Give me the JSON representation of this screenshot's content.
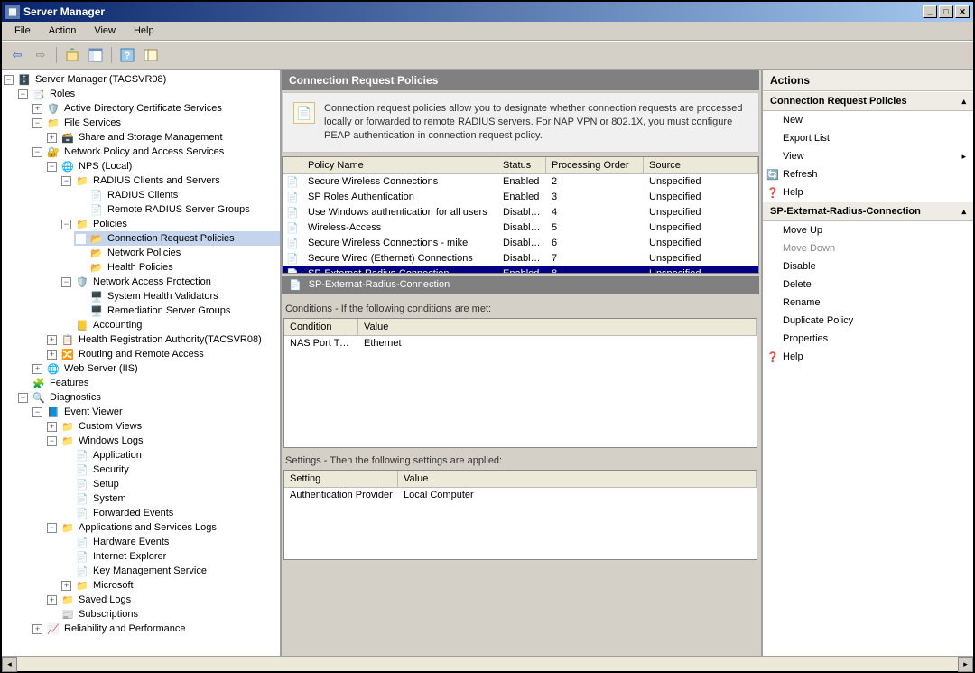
{
  "window": {
    "title": "Server Manager"
  },
  "menu": [
    "File",
    "Action",
    "View",
    "Help"
  ],
  "tree_root": "Server Manager (TACSVR08)",
  "tree": {
    "roles": "Roles",
    "adcs": "Active Directory Certificate Services",
    "file_services": "File Services",
    "share_storage": "Share and Storage Management",
    "npas": "Network Policy and Access Services",
    "nps_local": "NPS (Local)",
    "radius_cs": "RADIUS Clients and Servers",
    "radius_clients": "RADIUS Clients",
    "remote_radius": "Remote RADIUS Server Groups",
    "policies": "Policies",
    "crp": "Connection Request Policies",
    "network_policies": "Network Policies",
    "health_policies": "Health Policies",
    "nap": "Network Access Protection",
    "shv": "System Health Validators",
    "rsg": "Remediation Server Groups",
    "accounting": "Accounting",
    "hra": "Health Registration Authority(TACSVR08)",
    "rras": "Routing and Remote Access",
    "web_server": "Web Server (IIS)",
    "features": "Features",
    "diagnostics": "Diagnostics",
    "event_viewer": "Event Viewer",
    "custom_views": "Custom Views",
    "windows_logs": "Windows Logs",
    "app_log": "Application",
    "sec_log": "Security",
    "setup_log": "Setup",
    "system_log": "System",
    "fwd_events": "Forwarded Events",
    "app_svc_logs": "Applications and Services Logs",
    "hw_events": "Hardware Events",
    "ie": "Internet Explorer",
    "kms": "Key Management Service",
    "microsoft": "Microsoft",
    "saved_logs": "Saved Logs",
    "subscriptions": "Subscriptions",
    "reliability": "Reliability and Performance"
  },
  "center": {
    "title": "Connection Request Policies",
    "info": "Connection request policies allow you to designate whether connection requests are processed locally or forwarded to remote RADIUS servers. For NAP VPN or 802.1X, you must configure PEAP authentication in connection request policy.",
    "columns": {
      "name": "Policy Name",
      "status": "Status",
      "order": "Processing Order",
      "source": "Source"
    },
    "rows": [
      {
        "name": "Secure Wireless Connections",
        "status": "Enabled",
        "order": "2",
        "source": "Unspecified"
      },
      {
        "name": "SP Roles Authentication",
        "status": "Enabled",
        "order": "3",
        "source": "Unspecified"
      },
      {
        "name": "Use Windows authentication for all users",
        "status": "Disabled",
        "order": "4",
        "source": "Unspecified"
      },
      {
        "name": "Wireless-Access",
        "status": "Disabled",
        "order": "5",
        "source": "Unspecified"
      },
      {
        "name": "Secure Wireless Connections - mike",
        "status": "Disabled",
        "order": "6",
        "source": "Unspecified"
      },
      {
        "name": "Secure Wired (Ethernet) Connections",
        "status": "Disabled",
        "order": "7",
        "source": "Unspecified"
      },
      {
        "name": "SP-Externat-Radius-Connection",
        "status": "Enabled",
        "order": "8",
        "source": "Unspecified"
      }
    ],
    "selected_policy": "SP-Externat-Radius-Connection",
    "conditions_label": "Conditions - If the following conditions are met:",
    "cond_cols": {
      "cond": "Condition",
      "val": "Value"
    },
    "cond_rows": [
      {
        "cond": "NAS Port Type",
        "val": "Ethernet"
      }
    ],
    "settings_label": "Settings - Then the following settings are applied:",
    "set_cols": {
      "set": "Setting",
      "val": "Value"
    },
    "set_rows": [
      {
        "set": "Authentication Provider",
        "val": "Local Computer"
      }
    ]
  },
  "actions": {
    "title": "Actions",
    "group1": "Connection Request Policies",
    "group1_items": [
      {
        "label": "New",
        "icon": ""
      },
      {
        "label": "Export List",
        "icon": ""
      },
      {
        "label": "View",
        "icon": "",
        "arrow": true
      },
      {
        "label": "Refresh",
        "icon": "🔄"
      },
      {
        "label": "Help",
        "icon": "❓"
      }
    ],
    "group2": "SP-Externat-Radius-Connection",
    "group2_items": [
      {
        "label": "Move Up",
        "icon": ""
      },
      {
        "label": "Move Down",
        "icon": "",
        "disabled": true
      },
      {
        "label": "Disable",
        "icon": ""
      },
      {
        "label": "Delete",
        "icon": ""
      },
      {
        "label": "Rename",
        "icon": ""
      },
      {
        "label": "Duplicate Policy",
        "icon": ""
      },
      {
        "label": "Properties",
        "icon": ""
      },
      {
        "label": "Help",
        "icon": "❓"
      }
    ]
  }
}
